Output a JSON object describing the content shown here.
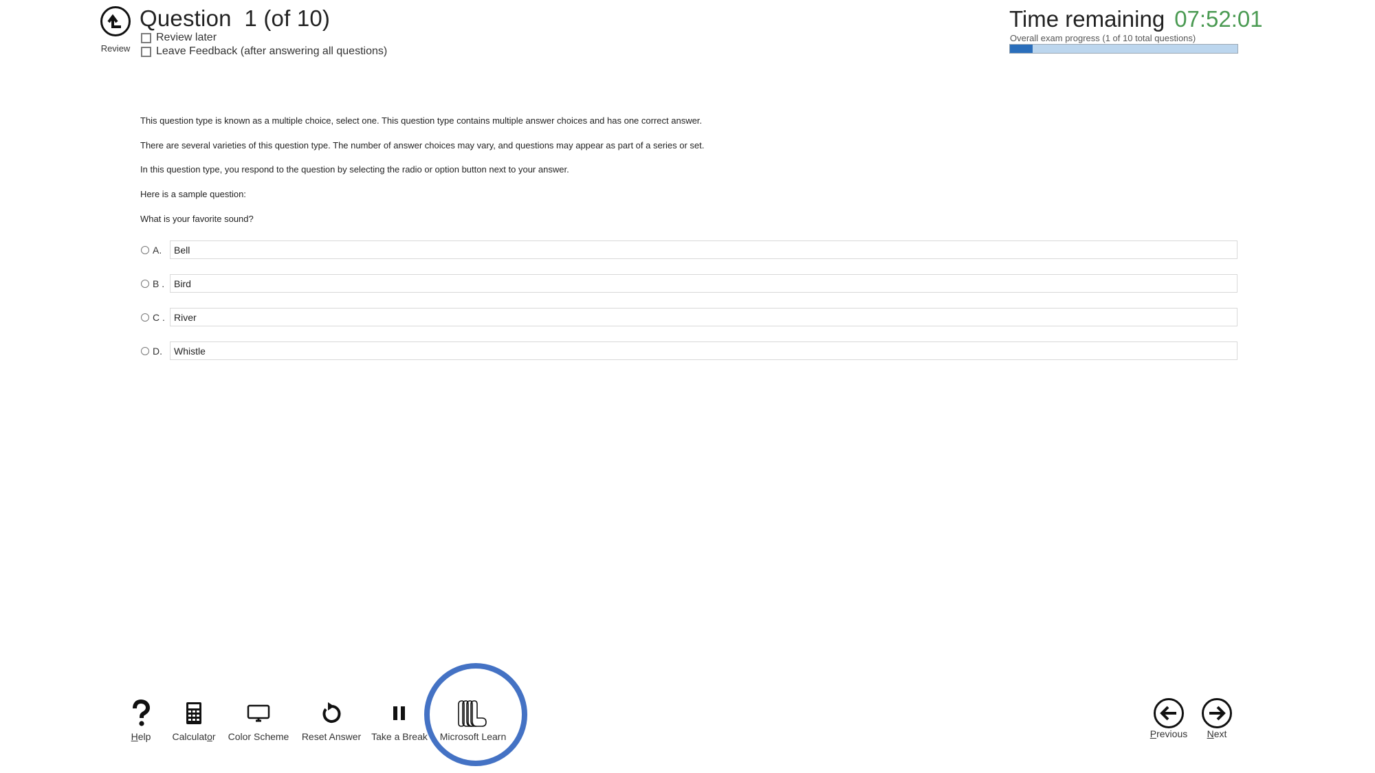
{
  "header": {
    "review_label": "Review",
    "question_title": "Question  1 (of 10)",
    "review_later_label": "Review later",
    "leave_feedback_label": "Leave Feedback (after answering all questions)",
    "time_label": "Time remaining",
    "time_value": "07:52:01",
    "progress_label": "Overall exam progress (1 of 10 total questions)",
    "progress_fraction": 0.1
  },
  "body": {
    "paragraphs": [
      "This question type is known as a multiple choice, select one. This question type contains multiple answer choices and has one correct answer.",
      "There are several varieties of this question type. The number of answer choices may vary, and questions may appear as part of a series or set.",
      "In this question type, you respond to the question by selecting the radio or option button next to your answer.",
      "Here is a sample question:",
      "What is your favorite sound?"
    ],
    "options": [
      {
        "letter": "A.",
        "text": "Bell"
      },
      {
        "letter": "B .",
        "text": "Bird"
      },
      {
        "letter": "C .",
        "text": "River"
      },
      {
        "letter": "D.",
        "text": "Whistle"
      }
    ]
  },
  "footer": {
    "tools": [
      {
        "icon": "help-icon",
        "label_pre": "",
        "label_u": "H",
        "label_post": "elp"
      },
      {
        "icon": "calculator-icon",
        "label_pre": "Calculat",
        "label_u": "o",
        "label_post": "r"
      },
      {
        "icon": "monitor-icon",
        "label_pre": "Color Scheme",
        "label_u": "",
        "label_post": ""
      },
      {
        "icon": "reset-icon",
        "label_pre": "Reset Answer",
        "label_u": "",
        "label_post": ""
      },
      {
        "icon": "pause-icon",
        "label_pre": "Take a Break",
        "label_u": "",
        "label_post": ""
      },
      {
        "icon": "microsoft-learn-icon",
        "label_pre": "Microsoft Learn",
        "label_u": "",
        "label_post": ""
      }
    ],
    "nav": {
      "previous": {
        "label_u": "P",
        "label_post": "revious"
      },
      "next": {
        "label_u": "N",
        "label_post": "ext"
      }
    },
    "highlight_color": "#4472c4"
  },
  "colors": {
    "timer_green": "#4a9a52",
    "progress_fill": "#2a6ebb",
    "progress_track": "#bcd6ee"
  }
}
